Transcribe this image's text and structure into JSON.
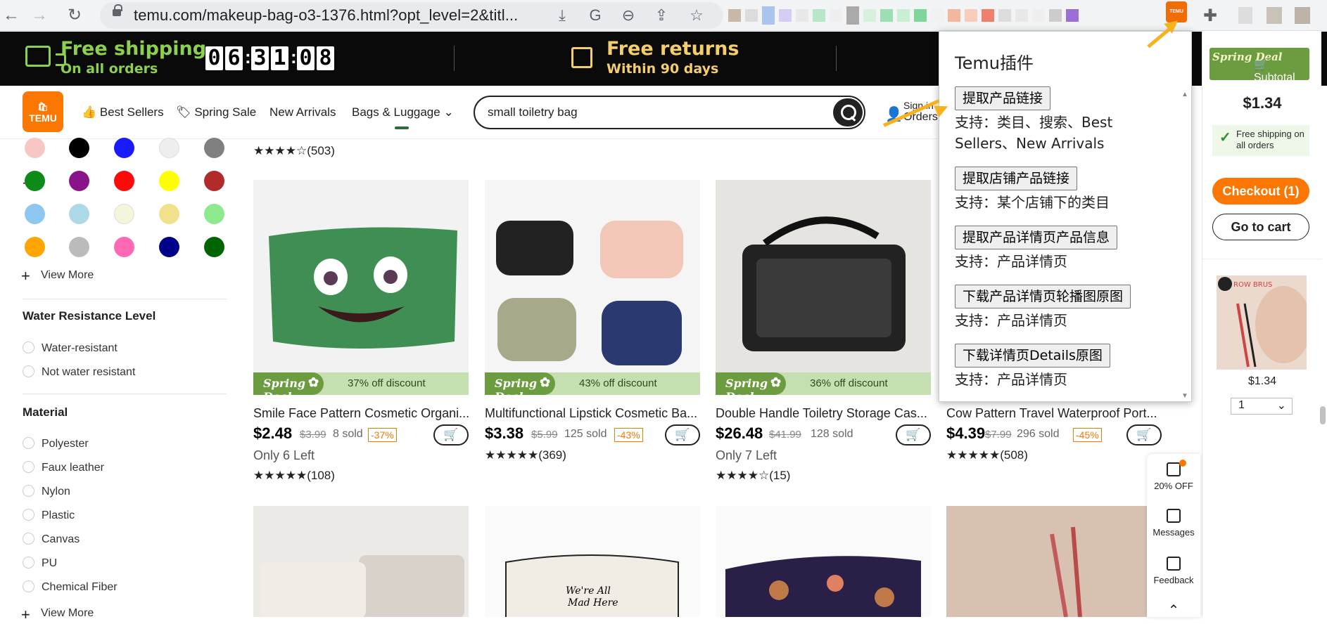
{
  "browser": {
    "url": "temu.com/makeup-bag-o3-1376.html?opt_level=2&titl...",
    "extension_label": "TEMU"
  },
  "promo": {
    "shipping_title": "Free shipping",
    "shipping_sub": "On all orders",
    "timer_digits": [
      "0",
      "6",
      "3",
      "1",
      "0",
      "8"
    ],
    "returns_title": "Free returns",
    "returns_sub": "Within 90 days"
  },
  "header": {
    "logo_text": "TEMU",
    "nav": [
      "Best Sellers",
      "Spring Sale",
      "New Arrivals",
      "Bags & Luggage"
    ],
    "search_value": "small toiletry bag",
    "signin": "Sign in",
    "orders": "Orders"
  },
  "sidebar": {
    "colors": [
      "#f7c7c3",
      "#000000",
      "#1a1aff",
      "#eeeeee",
      "#808080",
      "#0d8a17",
      "#8a138a",
      "#ff0a0a",
      "#ffff00",
      "#b22a2a",
      "#8ec8f0",
      "#add8e6",
      "#f5f5dc",
      "#f0e28a",
      "#8ee88e",
      "#ffa500",
      "#bbbbbb",
      "#ff69b4",
      "#00008b",
      "#006400"
    ],
    "view_more": "View More",
    "water_title": "Water Resistance Level",
    "water_options": [
      "Water-resistant",
      "Not water resistant"
    ],
    "material_title": "Material",
    "material_options": [
      "Polyester",
      "Faux leather",
      "Nylon",
      "Plastic",
      "Canvas",
      "PU",
      "Chemical Fiber"
    ],
    "view_more2": "View More"
  },
  "top_rating": "★★★★☆(503)",
  "products": [
    {
      "banner": "37% off discount",
      "title": "Smile Face Pattern Cosmetic Organi...",
      "price": "$2.48",
      "orig": "$3.99",
      "sold": "8 sold",
      "disc": "-37%",
      "left": "Only 6 Left",
      "rating": "★★★★★(108)"
    },
    {
      "banner": "43% off discount",
      "title": "Multifunctional Lipstick Cosmetic Ba...",
      "price": "$3.38",
      "orig": "$5.99",
      "sold": "125 sold",
      "disc": "-43%",
      "left": "",
      "rating": "★★★★★(369)"
    },
    {
      "banner": "36% off discount",
      "title": "Double Handle Toiletry Storage Cas...",
      "price": "$26.48",
      "orig": "$41.99",
      "sold": "128 sold",
      "disc": "",
      "left": "Only 7 Left",
      "rating": "★★★★☆(15)"
    },
    {
      "banner": "",
      "title": "Cow Pattern Travel Waterproof Port...",
      "price": "$4.39",
      "orig": "$7.99",
      "sold": "296 sold",
      "disc": "-45%",
      "left": "",
      "rating": "★★★★★(508)"
    }
  ],
  "deal_label": "Spring Deal",
  "popup": {
    "title": "Temu插件",
    "items": [
      {
        "button": "提取产品链接",
        "support": "支持：类目、搜索、Best Sellers、New Arrivals"
      },
      {
        "button": "提取店铺产品链接",
        "support": "支持：某个店铺下的类目"
      },
      {
        "button": "提取产品详情页产品信息",
        "support": "支持：产品详情页"
      },
      {
        "button": "下载产品详情页轮播图原图",
        "support": "支持：产品详情页"
      },
      {
        "button": "下载详情页Details原图",
        "support": "支持：产品详情页"
      }
    ]
  },
  "rail": {
    "spring": "Spring Deal",
    "subtotal": "Subtotal",
    "price": "$1.34",
    "free_shipping": "Free shipping on all orders",
    "checkout": "Checkout (1)",
    "goto_cart": "Go to cart",
    "item_img_text": "ROW BRUS",
    "item_price": "$1.34",
    "qty": "1"
  },
  "float": {
    "discount": "20% OFF",
    "messages": "Messages",
    "feedback": "Feedback"
  }
}
